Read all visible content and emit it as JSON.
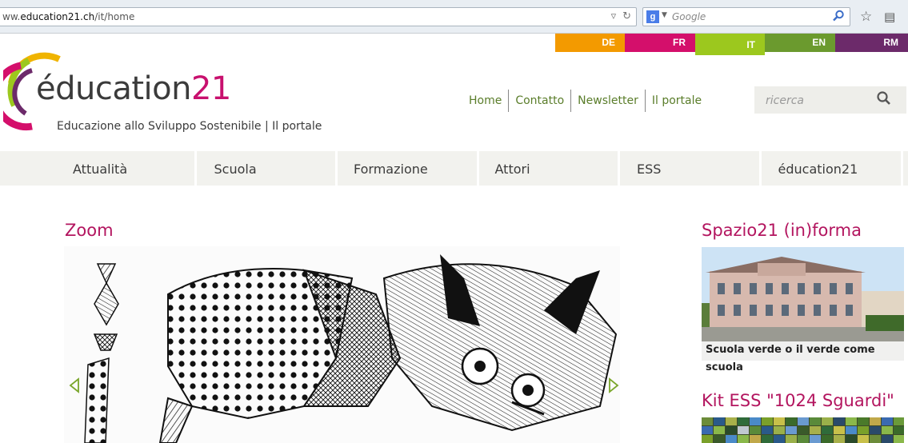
{
  "browser": {
    "url_prefix": "ww.",
    "url_domain": "education21.ch",
    "url_path": "/it/home",
    "search_engine_letter": "g",
    "search_placeholder": "Google"
  },
  "languages": [
    {
      "code": "DE",
      "color": "#f39a00"
    },
    {
      "code": "FR",
      "color": "#d40f6b"
    },
    {
      "code": "IT",
      "color": "#9cc81e",
      "active": true
    },
    {
      "code": "EN",
      "color": "#6b9a2e"
    },
    {
      "code": "RM",
      "color": "#6c2a6a"
    }
  ],
  "logo": {
    "word": "éducation",
    "number": "21",
    "tagline": "Educazione allo Sviluppo Sostenibile | Il portale"
  },
  "toplinks": [
    "Home",
    "Contatto",
    "Newsletter",
    "Il portale"
  ],
  "site_search": {
    "placeholder": "ricerca"
  },
  "nav": [
    "Attualità",
    "Scuola",
    "Formazione",
    "Attori",
    "ESS",
    "éducation21"
  ],
  "zoom": {
    "heading": "Zoom"
  },
  "spazio": {
    "heading": "Spazio21 (in)forma",
    "caption": "Scuola verde o il verde come scuola"
  },
  "kit": {
    "heading": "Kit ESS \"1024 Sguardi\""
  },
  "colors": {
    "accent": "#b3155f",
    "link_green": "#5a7d2a",
    "nav_bg": "#f2f2ee"
  }
}
